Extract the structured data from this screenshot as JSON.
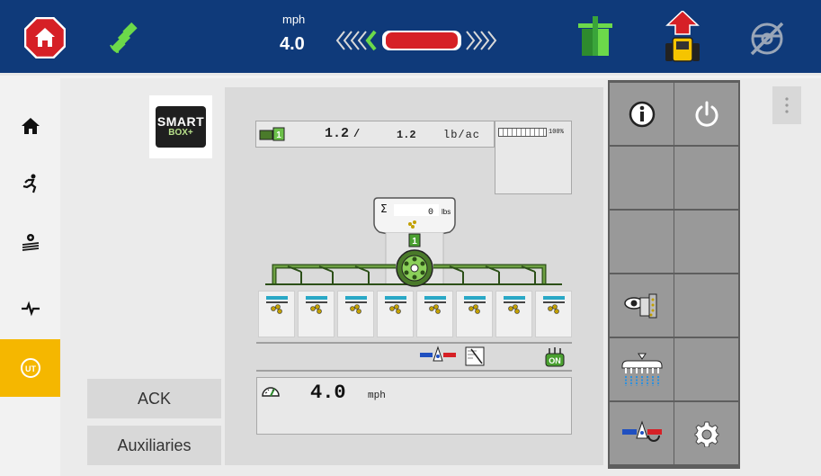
{
  "header": {
    "speed_unit": "mph",
    "speed_value": "4.0"
  },
  "product": {
    "rate_actual": "1.2",
    "rate_sep": "/",
    "rate_target": "1.2",
    "rate_unit": "lb/ac",
    "rate_percent": "100%",
    "section_number": "1",
    "total_value": "0",
    "total_unit": "lbs"
  },
  "ground_speed": {
    "value": "4.0",
    "unit": "mph"
  },
  "logo": {
    "line1": "SMART",
    "line2": "BOX+"
  },
  "buttons": {
    "ack": "ACK",
    "auxiliaries": "Auxiliaries"
  },
  "status": {
    "on_label": "ON"
  },
  "row_units": 8,
  "colors": {
    "header_bg": "#0f3a7a",
    "accent_yellow": "#f5b700",
    "boom_green": "#4a7a2a",
    "stop_red": "#d62026"
  }
}
